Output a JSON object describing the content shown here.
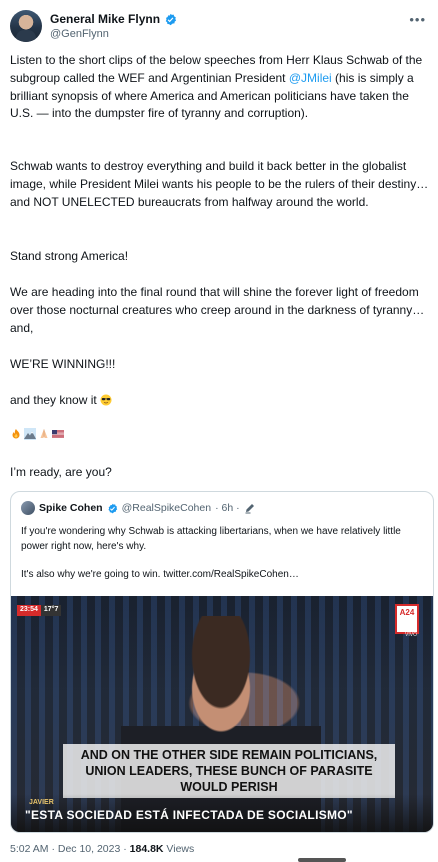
{
  "author": {
    "display_name": "General Mike Flynn",
    "handle": "@GenFlynn"
  },
  "tweet": {
    "p1_pre": "Listen to the short clips of the below speeches from Herr Klaus Schwab of the subgroup called the WEF and Argentinian President ",
    "p1_mention": "@JMilei",
    "p1_post": " (his is simply a brilliant synopsis of where America and American politicians have taken the U.S. — into the dumpster fire of tyranny and corruption).",
    "p2": "Schwab wants to destroy everything and build it back better in the globalist image, while President Milei wants his people to be the rulers of their destiny…and NOT UNELECTED bureaucrats from halfway around the world.",
    "p3": "Stand strong America!",
    "p4": "We are heading into the final round that will shine the forever light of freedom over those nocturnal creatures who creep around in the darkness of tyranny…and,",
    "p5": "WE’RE WINNING!!!",
    "p6": "and they know it",
    "p8": "I’m ready, are you?"
  },
  "quote": {
    "display_name": "Spike Cohen",
    "handle": "@RealSpikeCohen",
    "time": "· 6h ·",
    "text1": "If you're wondering why Schwab is attacking libertarians, when we have relatively little power right now, here's why.",
    "text2": "It's also why we're going to win.  twitter.com/RealSpikeCohen…",
    "video": {
      "badge_time": "23:54",
      "badge_temp": "17°7",
      "channel": "A24",
      "channel_sub": "VIVO",
      "caption": "AND ON THE OTHER SIDE REMAIN POLITICIANS, UNION LEADERS, THESE BUNCH OF PARASITE WOULD PERISH",
      "lower_name": "JAVIER",
      "lower_quote": "\"ESTA SOCIEDAD ESTÁ INFECTADA DE SOCIALISMO\""
    }
  },
  "footer": {
    "time_date": "5:02 AM · Dec 10, 2023 · ",
    "views_count": "184.8K",
    "views_label": " Views"
  },
  "colors": {
    "link": "#1d9bf0",
    "muted": "#536471",
    "text": "#0f1419"
  },
  "icons": [
    "verified-badge-icon",
    "more-icon",
    "pencil-icon",
    "sunglasses-emoji",
    "fire-emoji",
    "mountain-emoji",
    "praying-hands-emoji",
    "us-flag-emoji"
  ]
}
